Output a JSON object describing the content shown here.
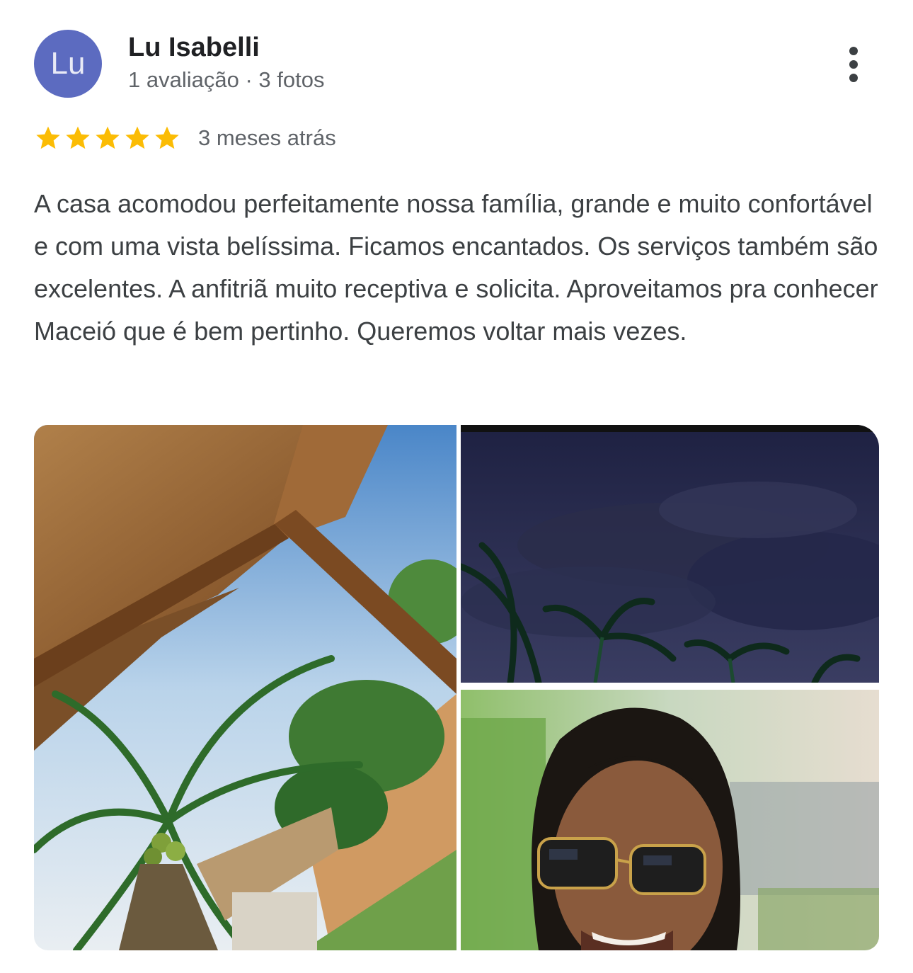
{
  "reviewer": {
    "initials": "Lu",
    "name": "Lu Isabelli",
    "meta": "1 avaliação · 3 fotos",
    "avatar_color": "#5c6bc0"
  },
  "more_menu": {
    "icon": "more-vert-icon"
  },
  "rating": {
    "stars": 5,
    "max_stars": 5,
    "star_color": "#fbbc04",
    "time_ago": "3 meses atrás"
  },
  "review": {
    "text": "A casa acomodou perfeitamente nossa família, grande e muito confortável e com uma vista belíssima. Ficamos encantados. Os serviços também são excelentes. A anfitriã muito receptiva e solicita. Aproveitamos pra conhecer Maceió que é bem pertinho. Queremos voltar mais vezes."
  }
}
